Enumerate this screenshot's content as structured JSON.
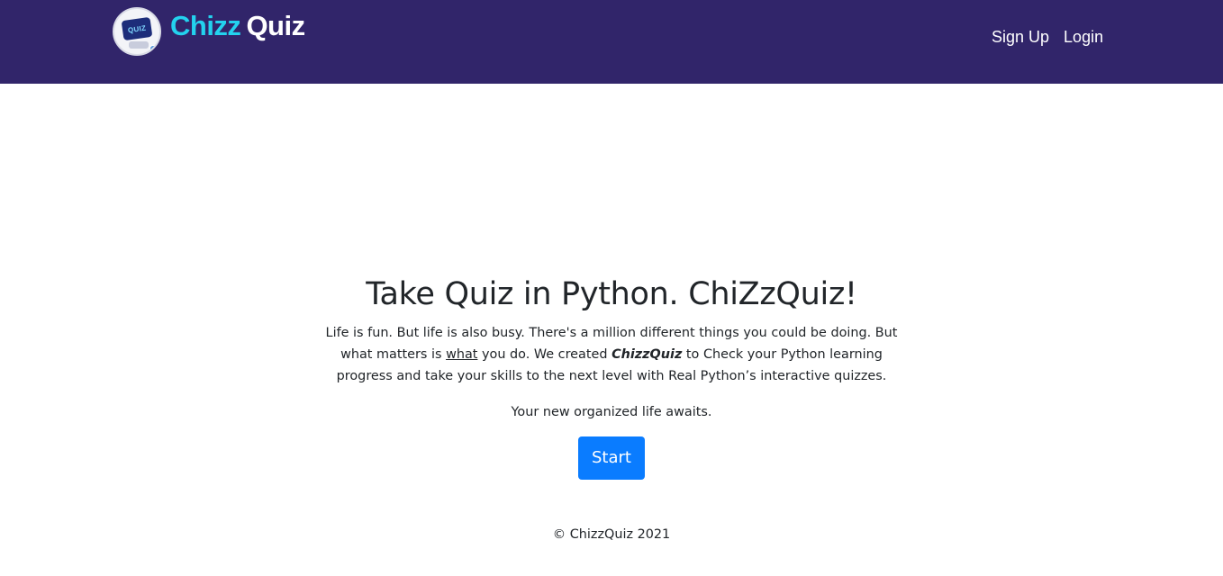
{
  "navbar": {
    "brand_part1": "Chizz",
    "brand_part2": "Quiz",
    "logo_text": "QUIZ",
    "links": [
      {
        "label": "Sign Up"
      },
      {
        "label": "Login"
      }
    ]
  },
  "hero": {
    "title": "Take Quiz in Python. ChiZzQuiz!",
    "lead_1": "Life is fun. But life is also busy. There's a million different things you could be doing. But what matters is ",
    "lead_underlined": "what",
    "lead_2": " you do. We created ",
    "lead_brand": "ChizzQuiz",
    "lead_3": " to Check your Python learning progress and take your skills to the next level with Real Python’s interactive quizzes.",
    "tagline": "Your new organized life awaits.",
    "start_label": "Start"
  },
  "footer": {
    "copyright": "© ChizzQuiz 2021"
  },
  "colors": {
    "navbar_bg": "#31256a",
    "brand_accent": "#23d2ee",
    "primary_button": "#0a7cff"
  },
  "icons": {
    "logo": "quiz-laptop-logo-icon"
  }
}
